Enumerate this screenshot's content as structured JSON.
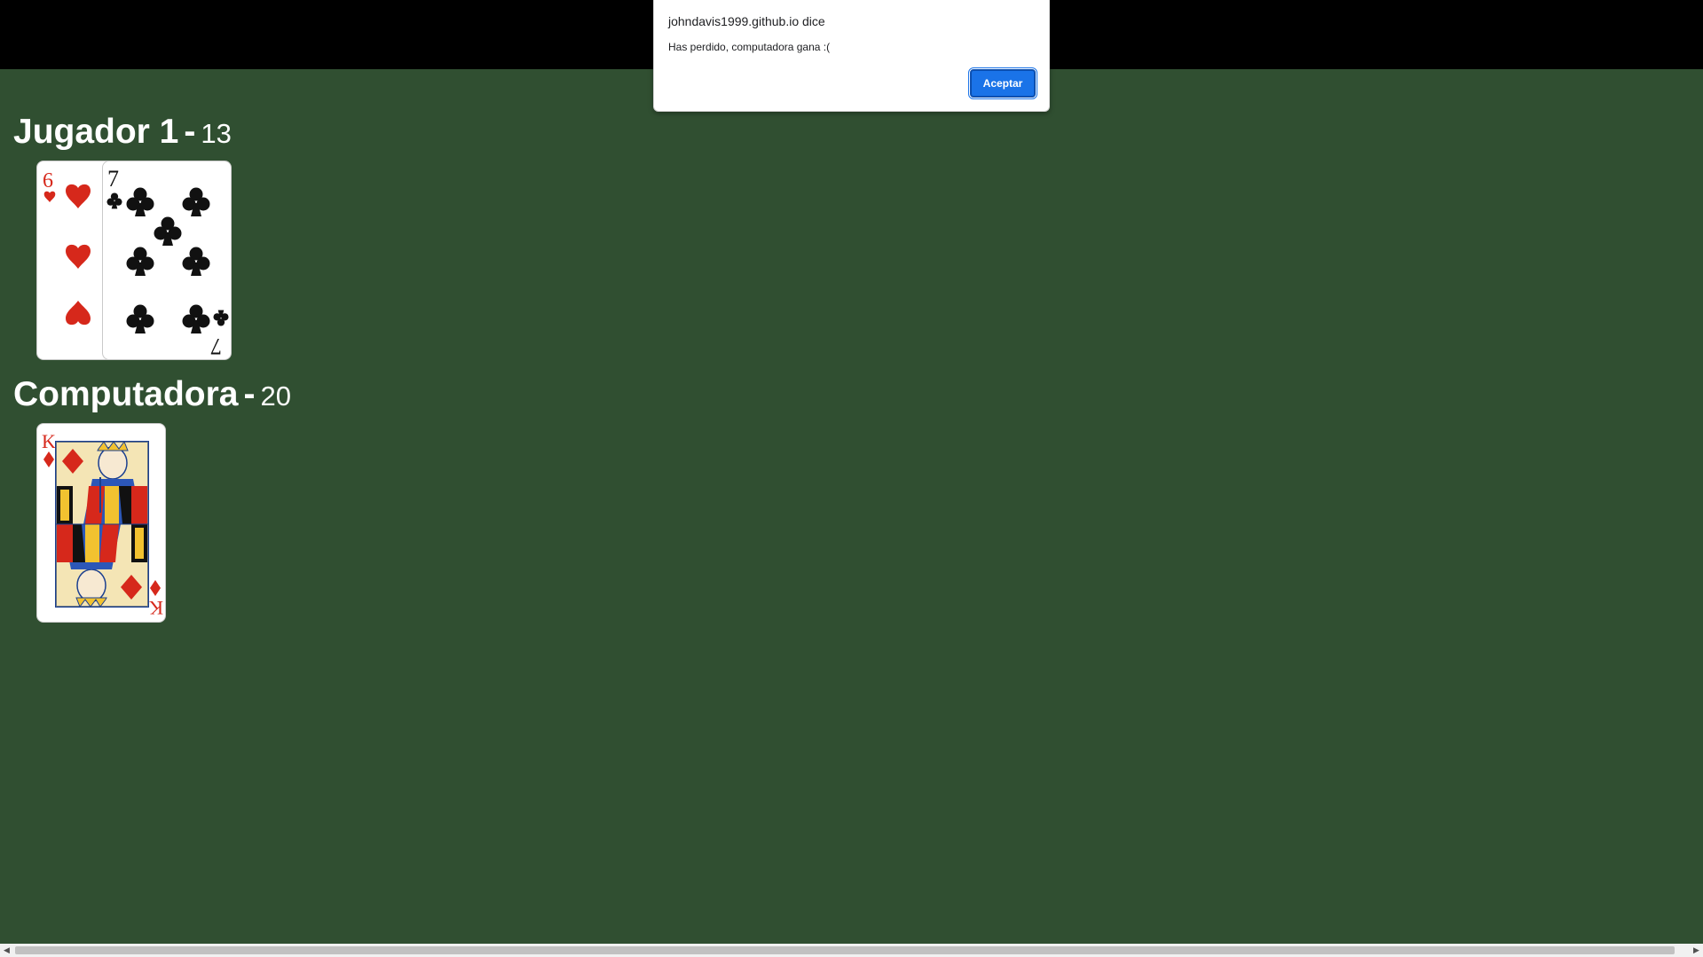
{
  "players": {
    "player": {
      "name": "Jugador 1",
      "separator": "-",
      "score": "13"
    },
    "computer": {
      "name": "Computadora",
      "separator": "-",
      "score": "20"
    }
  },
  "cards": {
    "player": [
      {
        "rank": "6",
        "suit": "hearts",
        "color": "#d6281b"
      },
      {
        "rank": "7",
        "suit": "clubs",
        "color": "#111111"
      }
    ],
    "computer": [
      {
        "rank": "K",
        "suit": "diamonds",
        "color": "#d6281b"
      }
    ]
  },
  "alert": {
    "origin": "johndavis1999.github.io dice",
    "message": "Has perdido, computadora gana :(",
    "ok_label": "Aceptar"
  },
  "colors": {
    "table_green": "#304f31",
    "top_bar": "#000000",
    "accent_blue": "#1a73e8"
  }
}
